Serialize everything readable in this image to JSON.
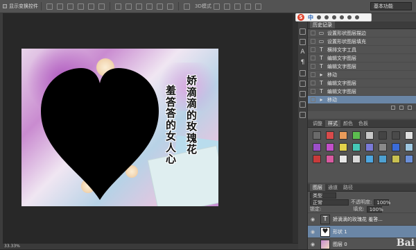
{
  "options_bar": {
    "show_transform_label": "显示变换控件",
    "mode_label": "3D模式",
    "workspace": "基本功能"
  },
  "ime_bar": {
    "logo": "S",
    "lang": "中"
  },
  "canvas": {
    "text_col1": [
      "羞",
      "答",
      "答",
      "的",
      "女",
      "人",
      "心"
    ],
    "text_col2": [
      "娇",
      "滴",
      "滴",
      "的",
      "玫",
      "瑰",
      "花"
    ]
  },
  "history_panel": {
    "tabs": [
      "历史记录"
    ],
    "items": [
      {
        "icon": "box",
        "label": "设置形状图层描边"
      },
      {
        "icon": "box",
        "label": "设置形状图层填充"
      },
      {
        "icon": "T",
        "label": "横排文字工具"
      },
      {
        "icon": "T",
        "label": "编辑文字图层"
      },
      {
        "icon": "T",
        "label": "编辑文字图层"
      },
      {
        "icon": "move",
        "label": "移动"
      },
      {
        "icon": "T",
        "label": "编辑文字图层"
      },
      {
        "icon": "T",
        "label": "编辑文字图层"
      },
      {
        "icon": "move",
        "label": "移动"
      }
    ]
  },
  "styles_panel": {
    "tabs": [
      "调整",
      "样式",
      "颜色",
      "色板"
    ],
    "swatches": [
      "#6a6a6a",
      "#d84b4b",
      "#e99b5a",
      "#5cbd4f",
      "#c8c8c8",
      "#444444",
      "#4a4a4a",
      "#e0e0e0",
      "#9b4fc9",
      "#c24fc9",
      "#e3d24a",
      "#45c8b6",
      "#7a7ad8",
      "#8a8a8a",
      "#3a6bd8",
      "#9ec7e0",
      "#c83a3a",
      "#d85aa0",
      "#e8e8e8",
      "#d8d8d8",
      "#4ea6e0",
      "#4ea0d0",
      "#c8c050",
      "#6b8fd8"
    ]
  },
  "layers_panel": {
    "tabs": [
      "图层",
      "通道",
      "路径"
    ],
    "kind_label": "类型",
    "blend_mode": "正常",
    "opacity_label": "不透明度:",
    "opacity_value": "100%",
    "lock_label": "锁定:",
    "fill_label": "填充:",
    "fill_value": "100%",
    "layers": [
      {
        "thumb": "T",
        "name": "娇滴滴的玫瑰花 羞答..."
      },
      {
        "thumb": "heart",
        "name": "形状 1"
      },
      {
        "thumb": "img",
        "name": "图层 0"
      }
    ]
  },
  "status": {
    "zoom": "33.33%"
  },
  "watermark": "Bai"
}
